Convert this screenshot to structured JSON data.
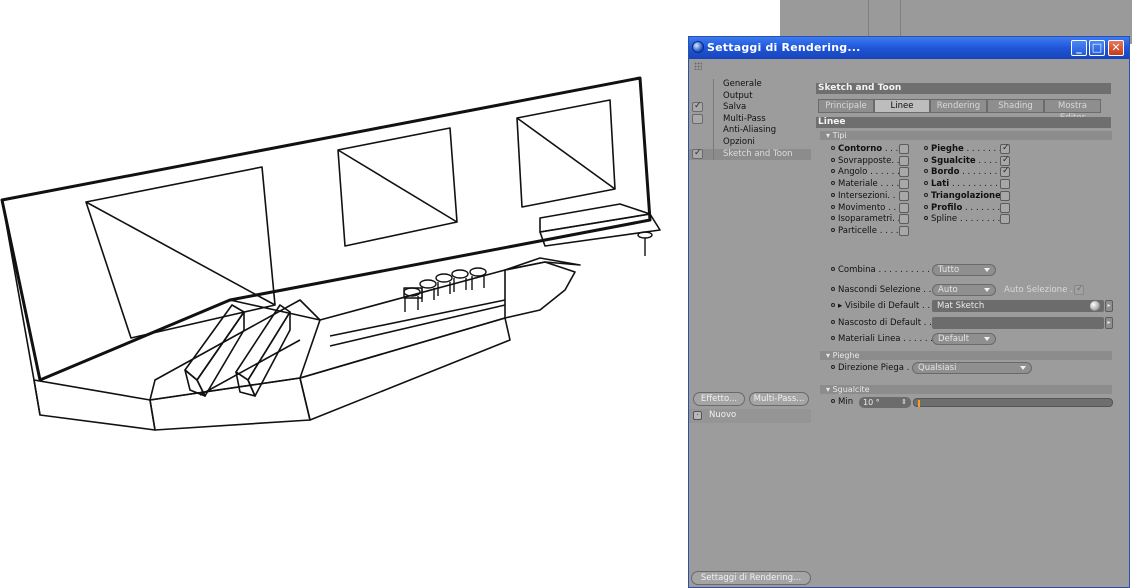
{
  "window": {
    "title": "Settaggi di Rendering..."
  },
  "categories": [
    {
      "label": "Generale",
      "checkbox": false,
      "checked": false
    },
    {
      "label": "Output",
      "checkbox": false,
      "checked": false
    },
    {
      "label": "Salva",
      "checkbox": true,
      "checked": true
    },
    {
      "label": "Multi-Pass",
      "checkbox": true,
      "checked": false
    },
    {
      "label": "Anti-Aliasing",
      "checkbox": false,
      "checked": false
    },
    {
      "label": "Opzioni",
      "checkbox": false,
      "checked": false
    },
    {
      "label": "Sketch and Toon",
      "checkbox": true,
      "checked": true,
      "selected": true
    }
  ],
  "left_buttons": {
    "effetto": "Effetto...",
    "multipass": "Multi-Pass..."
  },
  "post_list": {
    "item": "Nuovo"
  },
  "render_settings_button": "Settaggi di Rendering...",
  "content": {
    "section_title": "Sketch and Toon",
    "tabs": [
      {
        "label": "Principale",
        "active": false
      },
      {
        "label": "Linee",
        "active": true
      },
      {
        "label": "Rendering",
        "active": false
      },
      {
        "label": "Shading",
        "active": false
      },
      {
        "label": "Mostra Editor",
        "active": false
      }
    ],
    "subsection": "Linee",
    "types_group": "Tipi",
    "types_left": [
      {
        "label": "Contorno",
        "dots": " . . .",
        "bold": true,
        "checked": false
      },
      {
        "label": "Sovrapposte",
        "dots": ". .",
        "bold": false,
        "checked": false
      },
      {
        "label": "Angolo",
        "dots": " . . . . . .",
        "bold": false,
        "checked": false
      },
      {
        "label": "Materiale",
        "dots": " . . . .",
        "bold": false,
        "checked": false
      },
      {
        "label": "Intersezioni",
        "dots": ". .",
        "bold": false,
        "checked": false
      },
      {
        "label": "Movimento",
        "dots": " . . .",
        "bold": false,
        "checked": false
      },
      {
        "label": "Isoparametri",
        "dots": ". .",
        "bold": false,
        "checked": false
      },
      {
        "label": "Particelle",
        "dots": " . . . .",
        "bold": false,
        "checked": false
      }
    ],
    "types_right": [
      {
        "label": "Pieghe",
        "dots": " . . . . . . .",
        "bold": true,
        "checked": true
      },
      {
        "label": "Sgualcite",
        "dots": " . . . .",
        "bold": true,
        "checked": true
      },
      {
        "label": "Bordo",
        "dots": " . . . . . . .",
        "bold": true,
        "checked": true
      },
      {
        "label": "Lati",
        "dots": " . . . . . . . . .",
        "bold": true,
        "checked": false
      },
      {
        "label": "Triangolazione",
        "dots": "",
        "bold": true,
        "checked": false
      },
      {
        "label": "Profilo",
        "dots": " . . . . . . .",
        "bold": true,
        "checked": false
      },
      {
        "label": "Spline",
        "dots": " . . . . . . . .",
        "bold": false,
        "checked": false
      }
    ],
    "combina": {
      "label": "Combina",
      "dots": " . . . . . . . . . . . .",
      "value": "Tutto"
    },
    "nascondi": {
      "label": "Nascondi Selezione",
      "dots": " . . .",
      "value": "Auto"
    },
    "auto_selezione": {
      "label": "Auto Selezione",
      "dots": " . .",
      "checked": true
    },
    "visibile": {
      "label": "Visibile di Default",
      "dots": " . . .",
      "value": "Mat Sketch"
    },
    "nascosto": {
      "label": "Nascosto di Default",
      "dots": " . . .",
      "value": ""
    },
    "materiali": {
      "label": "Materiali Linea",
      "dots": " . . . . . . . .",
      "value": "Default"
    },
    "pieghe_group": "Pieghe",
    "direzione": {
      "label": "Direzione Piega",
      "dots": " . .",
      "value": "Qualsiasi"
    },
    "sgualcite_group": "Sgualcite",
    "min": {
      "label": "Min",
      "value": "10 °",
      "slider_fraction": 0.02
    }
  },
  "colors": {
    "titlebar": "#1f55d6",
    "panel": "#9c9c9c",
    "slider_accent": "#f2a11d"
  }
}
